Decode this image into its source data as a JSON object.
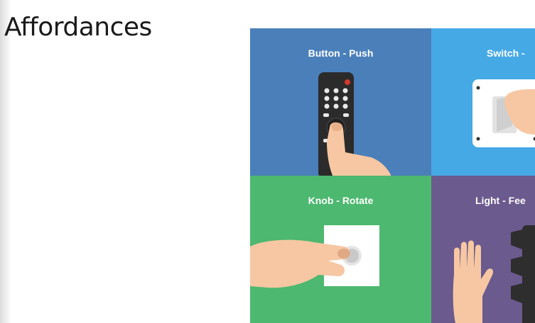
{
  "slide": {
    "title": "Affordances"
  },
  "panels": [
    {
      "label": "Button - Push",
      "color": "#4a7fba",
      "icon": "remote-control-hand-icon"
    },
    {
      "label": "Switch -",
      "color": "#45a9e5",
      "icon": "light-switch-hand-icon"
    },
    {
      "label": "Knob - Rotate",
      "color": "#4db86f",
      "icon": "knob-hand-icon"
    },
    {
      "label": "Light - Fee",
      "color": "#6b5a8e",
      "icon": "raised-hand-traffic-light-icon"
    }
  ]
}
